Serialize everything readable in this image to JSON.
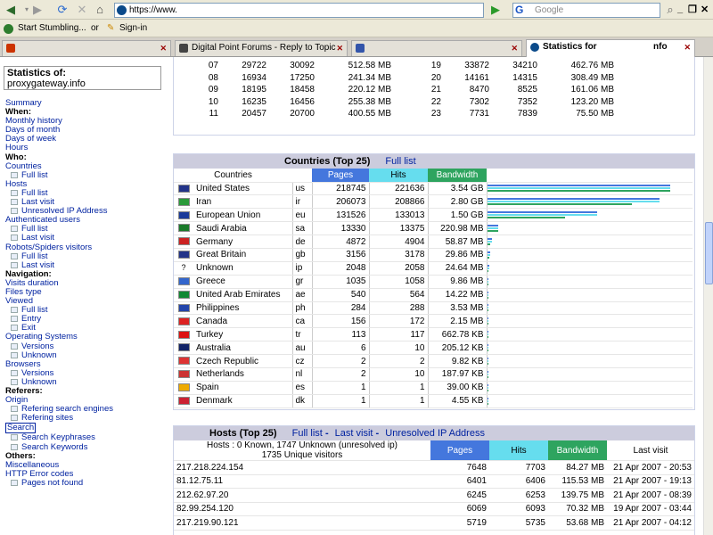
{
  "browser": {
    "url": "https://www.",
    "search_placeholder": "Google",
    "search_engine_label": "G",
    "bookmarks": [
      "Start Stumbling...",
      "or",
      "Sign-in"
    ],
    "tabs": [
      {
        "label": "",
        "active": false
      },
      {
        "label": "Digital Point Forums - Reply to Topic",
        "active": false
      },
      {
        "label": "",
        "active": false
      },
      {
        "label": "Statistics for",
        "suffix": "nfo",
        "active": true
      }
    ]
  },
  "sidebar": {
    "stats_of_label": "Statistics of:",
    "site": "proxygateway.info",
    "items": [
      {
        "kind": "link",
        "text": "Summary"
      },
      {
        "kind": "head",
        "text": "When:"
      },
      {
        "kind": "link",
        "text": "Monthly history"
      },
      {
        "kind": "link",
        "text": "Days of month"
      },
      {
        "kind": "link",
        "text": "Days of week"
      },
      {
        "kind": "link",
        "text": "Hours"
      },
      {
        "kind": "head",
        "text": "Who:"
      },
      {
        "kind": "link",
        "text": "Countries"
      },
      {
        "kind": "sub",
        "text": "Full list"
      },
      {
        "kind": "link",
        "text": "Hosts"
      },
      {
        "kind": "sub",
        "text": "Full list"
      },
      {
        "kind": "sub",
        "text": "Last visit"
      },
      {
        "kind": "sub",
        "text": "Unresolved IP Address"
      },
      {
        "kind": "link",
        "text": "Authenticated users"
      },
      {
        "kind": "sub",
        "text": "Full list"
      },
      {
        "kind": "sub",
        "text": "Last visit"
      },
      {
        "kind": "link",
        "text": "Robots/Spiders visitors"
      },
      {
        "kind": "sub",
        "text": "Full list"
      },
      {
        "kind": "sub",
        "text": "Last visit"
      },
      {
        "kind": "head",
        "text": "Navigation:"
      },
      {
        "kind": "link",
        "text": "Visits duration"
      },
      {
        "kind": "link",
        "text": "Files type"
      },
      {
        "kind": "link",
        "text": "Viewed"
      },
      {
        "kind": "sub",
        "text": "Full list"
      },
      {
        "kind": "sub",
        "text": "Entry"
      },
      {
        "kind": "sub",
        "text": "Exit"
      },
      {
        "kind": "link",
        "text": "Operating Systems"
      },
      {
        "kind": "sub",
        "text": "Versions"
      },
      {
        "kind": "sub",
        "text": "Unknown"
      },
      {
        "kind": "link",
        "text": "Browsers"
      },
      {
        "kind": "sub",
        "text": "Versions"
      },
      {
        "kind": "sub",
        "text": "Unknown"
      },
      {
        "kind": "head",
        "text": "Referers:"
      },
      {
        "kind": "link",
        "text": "Origin"
      },
      {
        "kind": "sub",
        "text": "Refering search engines"
      },
      {
        "kind": "sub",
        "text": "Refering sites"
      },
      {
        "kind": "boxed",
        "text": "Search"
      },
      {
        "kind": "sub",
        "text": "Search Keyphrases"
      },
      {
        "kind": "sub",
        "text": "Search Keywords"
      },
      {
        "kind": "head",
        "text": "Others:"
      },
      {
        "kind": "link",
        "text": "Miscellaneous"
      },
      {
        "kind": "link",
        "text": "HTTP Error codes"
      },
      {
        "kind": "sub",
        "text": "Pages not found"
      }
    ]
  },
  "hours": [
    [
      "07",
      "29722",
      "30092",
      "512.58 MB",
      "19",
      "33872",
      "34210",
      "462.76 MB"
    ],
    [
      "08",
      "16934",
      "17250",
      "241.34 MB",
      "20",
      "14161",
      "14315",
      "308.49 MB"
    ],
    [
      "09",
      "18195",
      "18458",
      "220.12 MB",
      "21",
      "8470",
      "8525",
      "161.06 MB"
    ],
    [
      "10",
      "16235",
      "16456",
      "255.38 MB",
      "22",
      "7302",
      "7352",
      "123.20 MB"
    ],
    [
      "11",
      "20457",
      "20700",
      "400.55 MB",
      "23",
      "7731",
      "7839",
      "75.50 MB"
    ]
  ],
  "countries": {
    "title": "Countries (Top 25)",
    "full_list": "Full list",
    "col_countries": "Countries",
    "col_pages": "Pages",
    "col_hits": "Hits",
    "col_bandwidth": "Bandwidth",
    "max_pages": 218745,
    "max_hits": 221636,
    "max_bw_mb": 3625,
    "rows": [
      {
        "name": "United States",
        "code": "us",
        "pages": "218745",
        "hits": "221636",
        "bw": "3.54 GB",
        "pv": 218745,
        "hv": 221636,
        "bv": 3625,
        "flag": "#223388"
      },
      {
        "name": "Iran",
        "code": "ir",
        "pages": "206073",
        "hits": "208866",
        "bw": "2.80 GB",
        "pv": 206073,
        "hv": 208866,
        "bv": 2867,
        "flag": "#2a9a3a"
      },
      {
        "name": "European Union",
        "code": "eu",
        "pages": "131526",
        "hits": "133013",
        "bw": "1.50 GB",
        "pv": 131526,
        "hv": 133013,
        "bv": 1536,
        "flag": "#1a3a9a"
      },
      {
        "name": "Saudi Arabia",
        "code": "sa",
        "pages": "13330",
        "hits": "13375",
        "bw": "220.98 MB",
        "pv": 13330,
        "hv": 13375,
        "bv": 220.98,
        "flag": "#1a7a2a"
      },
      {
        "name": "Germany",
        "code": "de",
        "pages": "4872",
        "hits": "4904",
        "bw": "58.87 MB",
        "pv": 4872,
        "hv": 4904,
        "bv": 58.87,
        "flag": "#cc2222"
      },
      {
        "name": "Great Britain",
        "code": "gb",
        "pages": "3156",
        "hits": "3178",
        "bw": "29.86 MB",
        "pv": 3156,
        "hv": 3178,
        "bv": 29.86,
        "flag": "#223388"
      },
      {
        "name": "Unknown",
        "code": "ip",
        "pages": "2048",
        "hits": "2058",
        "bw": "24.64 MB",
        "pv": 2048,
        "hv": 2058,
        "bv": 24.64,
        "flag": "#ffffff"
      },
      {
        "name": "Greece",
        "code": "gr",
        "pages": "1035",
        "hits": "1058",
        "bw": "9.86 MB",
        "pv": 1035,
        "hv": 1058,
        "bv": 9.86,
        "flag": "#3366cc"
      },
      {
        "name": "United Arab Emirates",
        "code": "ae",
        "pages": "540",
        "hits": "564",
        "bw": "14.22 MB",
        "pv": 540,
        "hv": 564,
        "bv": 14.22,
        "flag": "#118833"
      },
      {
        "name": "Philippines",
        "code": "ph",
        "pages": "284",
        "hits": "288",
        "bw": "3.53 MB",
        "pv": 284,
        "hv": 288,
        "bv": 3.53,
        "flag": "#2244aa"
      },
      {
        "name": "Canada",
        "code": "ca",
        "pages": "156",
        "hits": "172",
        "bw": "2.15 MB",
        "pv": 156,
        "hv": 172,
        "bv": 2.15,
        "flag": "#dd2222"
      },
      {
        "name": "Turkey",
        "code": "tr",
        "pages": "113",
        "hits": "117",
        "bw": "662.78 KB",
        "pv": 113,
        "hv": 117,
        "bv": 0.647,
        "flag": "#dd1111"
      },
      {
        "name": "Australia",
        "code": "au",
        "pages": "6",
        "hits": "10",
        "bw": "205.12 KB",
        "pv": 6,
        "hv": 10,
        "bv": 0.2,
        "flag": "#112266"
      },
      {
        "name": "Czech Republic",
        "code": "cz",
        "pages": "2",
        "hits": "2",
        "bw": "9.82 KB",
        "pv": 2,
        "hv": 2,
        "bv": 0.0096,
        "flag": "#dd3333"
      },
      {
        "name": "Netherlands",
        "code": "nl",
        "pages": "2",
        "hits": "10",
        "bw": "187.97 KB",
        "pv": 2,
        "hv": 10,
        "bv": 0.18,
        "flag": "#cc3333"
      },
      {
        "name": "Spain",
        "code": "es",
        "pages": "1",
        "hits": "1",
        "bw": "39.00 KB",
        "pv": 1,
        "hv": 1,
        "bv": 0.038,
        "flag": "#eeaa00"
      },
      {
        "name": "Denmark",
        "code": "dk",
        "pages": "1",
        "hits": "1",
        "bw": "4.55 KB",
        "pv": 1,
        "hv": 1,
        "bv": 0.0044,
        "flag": "#cc2233"
      }
    ]
  },
  "hosts": {
    "title": "Hosts (Top 25)",
    "links": [
      "Full list",
      "Last visit",
      "Unresolved IP Address"
    ],
    "summary_line1": "Hosts : 0 Known, 1747 Unknown (unresolved ip)",
    "summary_line2": "1735 Unique visitors",
    "col_pages": "Pages",
    "col_hits": "Hits",
    "col_bandwidth": "Bandwidth",
    "col_last_visit": "Last visit",
    "rows": [
      [
        "217.218.224.154",
        "7648",
        "7703",
        "84.27 MB",
        "21 Apr 2007 - 20:53"
      ],
      [
        "81.12.75.11",
        "6401",
        "6406",
        "115.53 MB",
        "21 Apr 2007 - 19:13"
      ],
      [
        "212.62.97.20",
        "6245",
        "6253",
        "139.75 MB",
        "21 Apr 2007 - 08:39"
      ],
      [
        "82.99.254.120",
        "6069",
        "6093",
        "70.32 MB",
        "19 Apr 2007 - 03:44"
      ],
      [
        "217.219.90.121",
        "5719",
        "5735",
        "53.68 MB",
        "21 Apr 2007 - 04:12"
      ]
    ]
  },
  "colors": {
    "pages": "#4477dd",
    "hits": "#66ddee",
    "bandwidth": "#2ea45f",
    "link": "#0022a0"
  }
}
